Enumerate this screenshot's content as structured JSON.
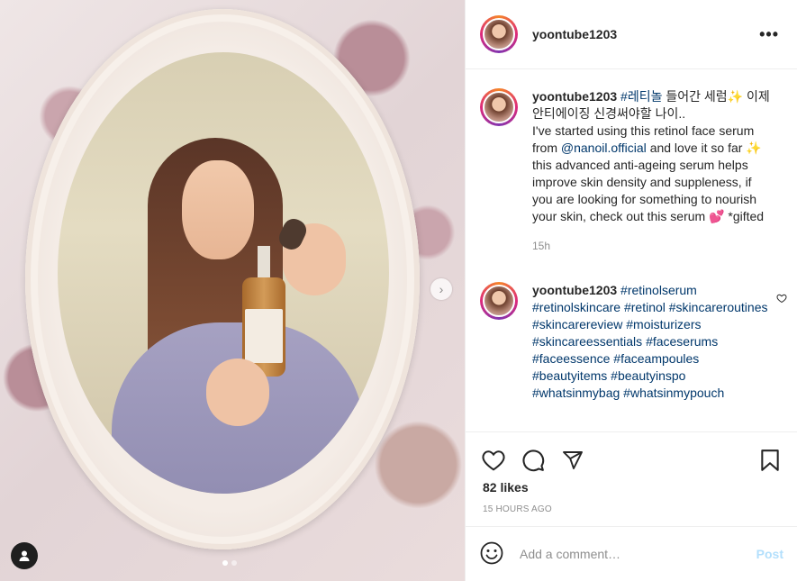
{
  "post": {
    "username": "yoontube1203",
    "image_alt": "",
    "carousel": {
      "current": 1,
      "total": 2
    }
  },
  "caption": {
    "username": "yoontube1203",
    "hashtag": "#레티놀",
    "text_ko": "들어간 세럼✨ 이제 안티에이징 신경써야할 나이..",
    "text_en_1": "I've started using this retinol face serum from",
    "mention": "@nanoil.official",
    "text_en_2": "and love it so far ✨ this advanced anti-ageing serum helps improve skin density and suppleness, if you are looking for something to nourish your skin, check out this serum 💕 *gifted",
    "time": "15h"
  },
  "comment": {
    "username": "yoontube1203",
    "hashtags": [
      "#retinolserum",
      "#retinolskincare",
      "#retinol",
      "#skincareroutines",
      "#skincarereview",
      "#moisturizers",
      "#skincareessentials",
      "#faceserums",
      "#faceessence",
      "#faceampoules",
      "#beautyitems",
      "#beautyinspo",
      "#whatsinmybag",
      "#whatsinmypouch"
    ]
  },
  "actions": {
    "likes": "82 likes",
    "time_ago": "15 HOURS AGO"
  },
  "add_comment": {
    "placeholder": "Add a comment…",
    "post_label": "Post"
  },
  "colors": {
    "link": "#00376b",
    "muted": "#8e8e8e",
    "post_disabled": "#b2dffc"
  }
}
